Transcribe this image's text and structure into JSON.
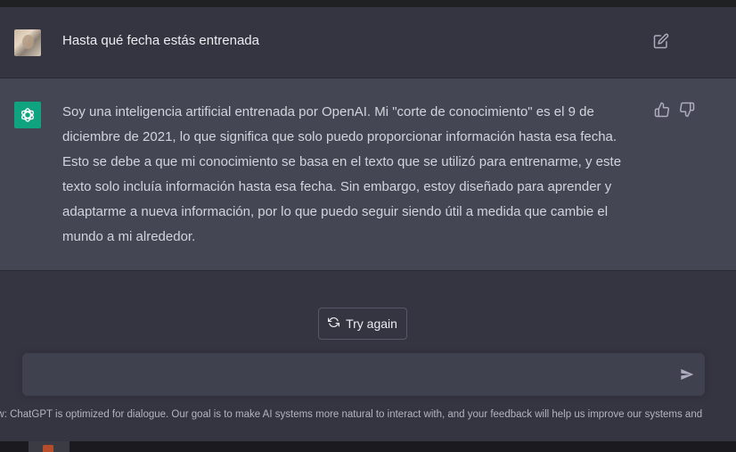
{
  "conversation": {
    "user_message": "Hasta qué fecha estás entrenada",
    "assistant_message": "Soy una inteligencia artificial entrenada por OpenAI. Mi \"corte de conocimiento\" es el 9 de diciembre de 2021, lo que significa que solo puedo proporcionar información hasta esa fecha. Esto se debe a que mi conocimiento se basa en el texto que se utilizó para entrenarme, y este texto solo incluía información hasta esa fecha. Sin embargo, estoy diseñado para aprender y adaptarme a nueva información, por lo que puedo seguir siendo útil a medida que cambie el mundo a mi alrededor."
  },
  "actions": {
    "try_again_label": "Try again"
  },
  "composer": {
    "placeholder": ""
  },
  "footer": {
    "text": "ew: ChatGPT is optimized for dialogue. Our goal is to make AI systems more natural to interact with, and your feedback will help us improve our systems and"
  },
  "icons": {
    "user_avatar": "user-avatar",
    "assistant_avatar": "openai-logo-icon",
    "edit": "edit-icon",
    "thumbs_up": "thumbs-up-icon",
    "thumbs_down": "thumbs-down-icon",
    "refresh": "refresh-icon",
    "send": "send-icon"
  },
  "colors": {
    "background": "#343541",
    "assistant_background": "#444654",
    "brand_green": "#10a37f"
  }
}
